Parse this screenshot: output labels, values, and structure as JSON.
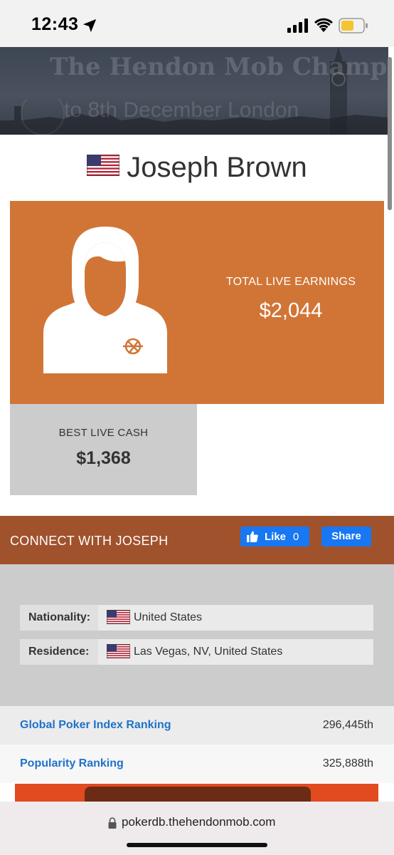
{
  "status_bar": {
    "time": "12:43",
    "icons": [
      "location-arrow-icon",
      "cellular-signal-icon",
      "wifi-icon",
      "battery-icon"
    ],
    "battery_color": "#f5c430"
  },
  "banner": {
    "title": "The Hendon Mob Championship",
    "subtitle": "to 8th December London"
  },
  "player": {
    "name": "Joseph Brown",
    "flag_icon": "us-flag-icon"
  },
  "earnings": {
    "total_label": "TOTAL LIVE EARNINGS",
    "total_value": "$2,044",
    "best_label": "BEST LIVE CASH",
    "best_value": "$1,368",
    "card_color": "#d17537"
  },
  "connect": {
    "label": "CONNECT WITH JOSEPH",
    "like_label": "Like",
    "like_count": "0",
    "share_label": "Share",
    "bar_color": "#a0522d"
  },
  "info": [
    {
      "key": "Nationality:",
      "value": "United States"
    },
    {
      "key": "Residence:",
      "value": "Las Vegas, NV, United States"
    }
  ],
  "rankings": [
    {
      "label": "Global Poker Index Ranking",
      "value": "296,445th"
    },
    {
      "label": "Popularity Ranking",
      "value": "325,888th"
    }
  ],
  "url_bar": {
    "url": "pokerdb.thehendonmob.com"
  }
}
